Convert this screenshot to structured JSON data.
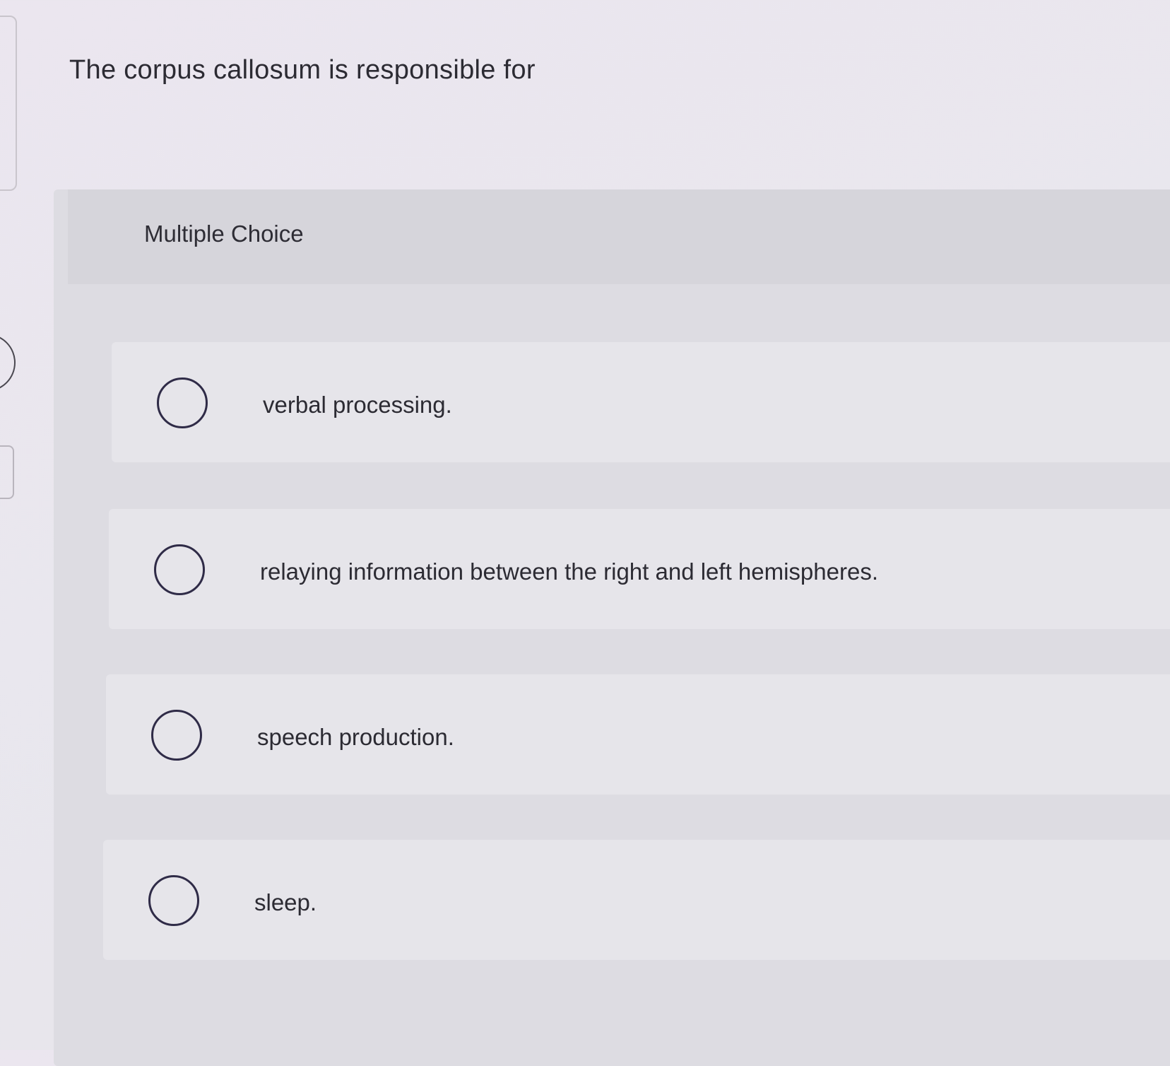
{
  "question": {
    "text": "The corpus callosum is responsible for"
  },
  "panel": {
    "label": "Multiple Choice"
  },
  "options": [
    {
      "label": "verbal processing."
    },
    {
      "label": "relaying information between the right and left hemispheres."
    },
    {
      "label": "speech production."
    },
    {
      "label": "sleep."
    }
  ]
}
